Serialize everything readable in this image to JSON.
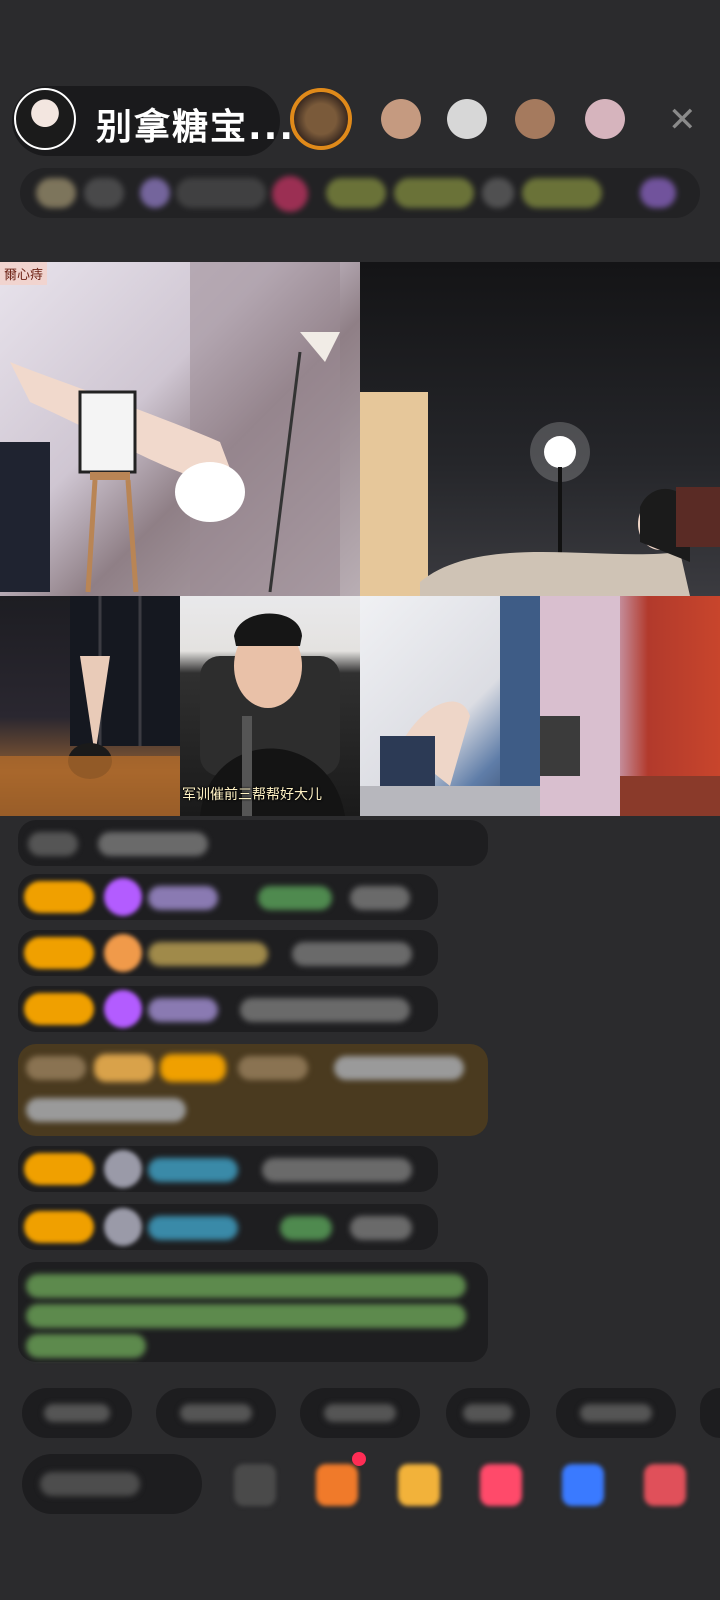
{
  "header": {
    "host_name": "别拿糖宝...",
    "close_glyph": "✕",
    "viewer_colors": [
      "#e08a1a",
      "#b98a78",
      "#c7c7c7",
      "#a57a5e",
      "#c9a9b3"
    ]
  },
  "stream": {
    "corner_tag": "爾心痔",
    "subtitle": "军训催前三帮帮好大儿"
  },
  "icons": {
    "host_avatar": "host-avatar",
    "close": "close-icon",
    "gift": "gift-icon"
  },
  "colors": {
    "background": "#2b2b2d",
    "level_badge": "#f0a000",
    "highlight_message": "#4a3a1f",
    "system_text": "#7fc97f"
  }
}
